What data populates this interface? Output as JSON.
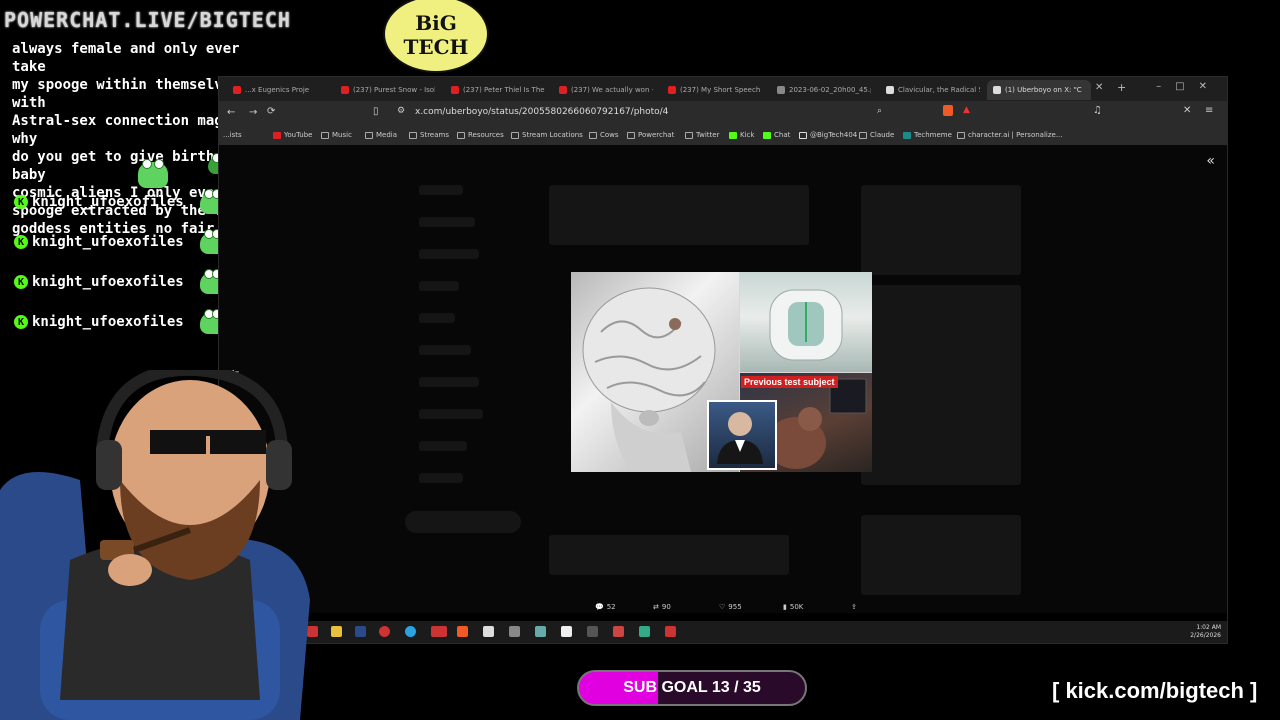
{
  "overlay": {
    "banner": "POWERCHAT.LIVE/BIGTECH",
    "logo_text": "BiG TECH",
    "sub_goal": "SUB GOAL 13 / 35",
    "kick_url": "[ kick.com/bigtech ]"
  },
  "chat": {
    "message": "always female and only ever take\nmy spooge within themselves with\nAstral-sex connection magic, why\ndo you get to give birth to baby\ncosmic aliens I only ever get\nspooge extracted by the female\ngoddess entities no fair",
    "rows": [
      {
        "user": "knight_ufoexofiles"
      },
      {
        "user": "knight_ufoexofiles"
      },
      {
        "user": "knight_ufoexofiles"
      },
      {
        "user": "knight_ufoexofiles"
      }
    ]
  },
  "browser": {
    "tabs": [
      {
        "label": "...x Eugenics Proje",
        "color": "#e02020"
      },
      {
        "label": "(237) Purest Snow - Isolatio",
        "color": "#e02020"
      },
      {
        "label": "(237) Peter Thiel Is The Mos",
        "color": "#e02020"
      },
      {
        "label": "(237) We actually won - You",
        "color": "#e02020"
      },
      {
        "label": "(237) My Short Speech At W",
        "color": "#e02020"
      },
      {
        "label": "2023-06-02_20h00_45.png",
        "color": "#888888"
      },
      {
        "label": "Clavicular, the Radical Sube",
        "color": "#dddddd"
      },
      {
        "label": "(1) Uberboyo on X: \"C",
        "color": "#dddddd"
      }
    ],
    "url": "x.com/uberboyo/status/2005580266060792167/photo/4",
    "bookmarks": [
      "YouTube",
      "Music",
      "Media",
      "Streams",
      "Resources",
      "Stream Locations",
      "Cows",
      "Powerchat",
      "Twitter",
      "Kick",
      "Chat",
      "@BigTech404",
      "Claude",
      "Techmeme",
      "character.ai | Personalize..."
    ],
    "bookmarks_prefix": "...ists"
  },
  "photo": {
    "caption": "Previous test subject"
  },
  "post_actions": {
    "replies": "52",
    "reposts": "90",
    "likes": "955",
    "views": "50K"
  },
  "clock": {
    "time": "1:02 AM",
    "date": "2/26/2026"
  },
  "colors": {
    "kick_green": "#53fc18",
    "sub_goal_fill": "#e000e0",
    "caption_red": "#d11f1f"
  }
}
